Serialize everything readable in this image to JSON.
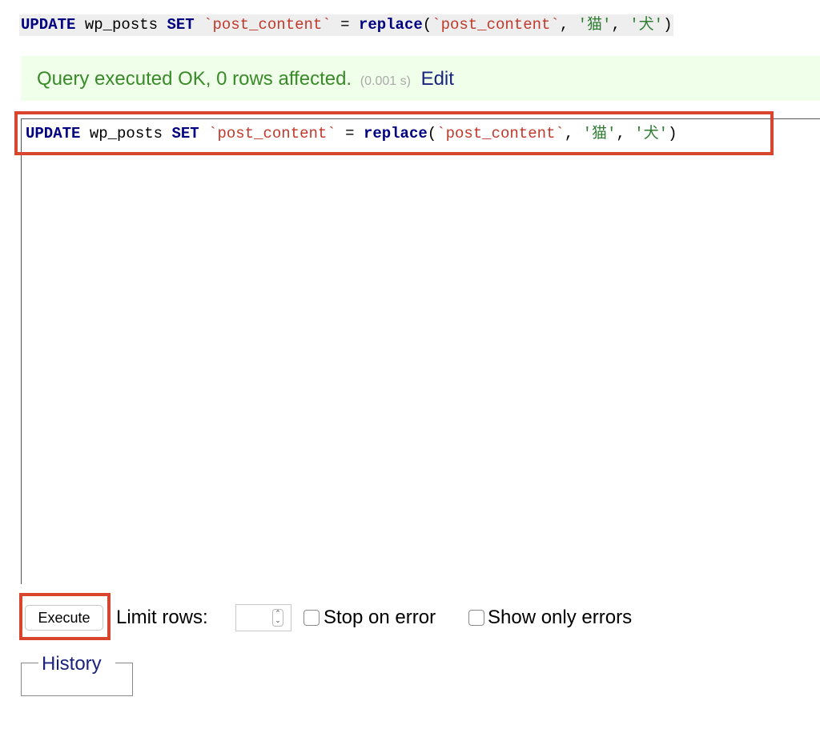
{
  "query_display": {
    "keyword_update": "UPDATE",
    "table": "wp_posts",
    "keyword_set": "SET",
    "column": "`post_content`",
    "equals": "=",
    "function": "replace",
    "open_paren": "(",
    "arg_column": "`post_content`",
    "comma1": ",",
    "arg_find": "'猫'",
    "comma2": ",",
    "arg_replace": "'犬'",
    "close_paren": ")"
  },
  "message": {
    "text": "Query executed OK, 0 rows affected.",
    "time": "(0.001 s)",
    "edit_link": "Edit"
  },
  "editor": {
    "keyword_update": "UPDATE",
    "table": "wp_posts",
    "keyword_set": "SET",
    "column": "`post_content`",
    "equals": "=",
    "function": "replace",
    "open_paren": "(",
    "arg_column": "`post_content`",
    "comma1": ",",
    "arg_find": "'猫'",
    "comma2": ",",
    "arg_replace": "'犬'",
    "close_paren": ")"
  },
  "controls": {
    "execute_label": "Execute",
    "limit_rows_label": "Limit rows:",
    "limit_rows_value": "",
    "stop_on_error_label": "Stop on error",
    "stop_on_error_checked": false,
    "show_only_errors_label": "Show only errors",
    "show_only_errors_checked": false
  },
  "history": {
    "legend": "History"
  },
  "colors": {
    "highlight_border": "#d9442c",
    "success_bg": "#efffea",
    "success_text": "#3a8a2a",
    "link": "#1a237e",
    "sql_keyword": "#000080",
    "sql_identifier": "#c0392b",
    "sql_string": "#2e7d32"
  }
}
